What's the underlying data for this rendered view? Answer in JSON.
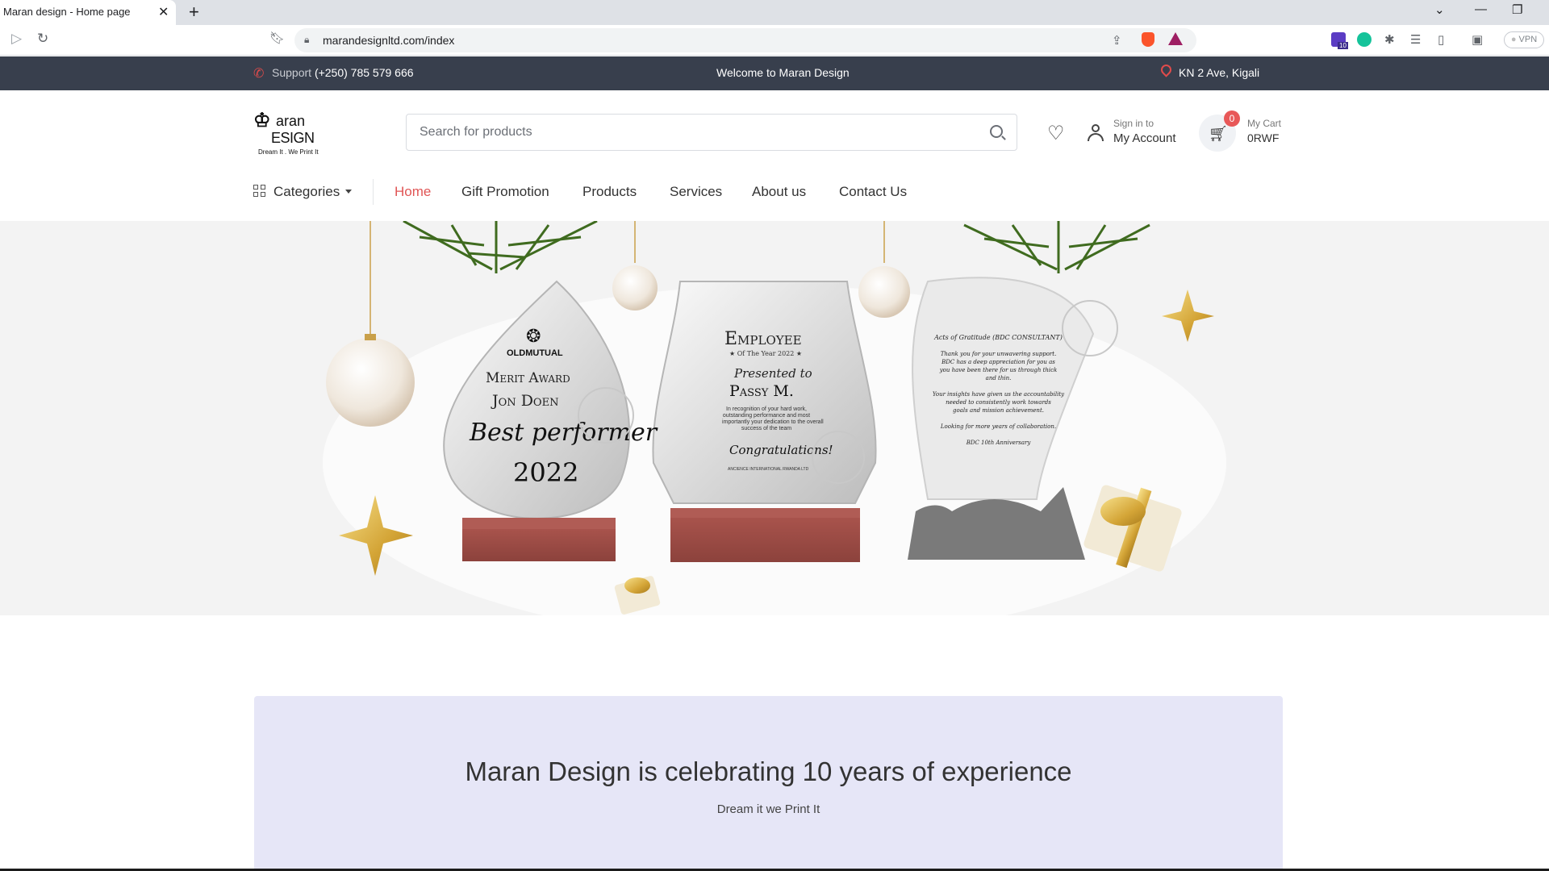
{
  "browser": {
    "tab_title": "Maran design - Home page",
    "url": "marandesignltd.com/index",
    "vpn_label": "VPN",
    "ext_badge": "10"
  },
  "topbar": {
    "support_label": "Support",
    "support_phone": "(+250) 785 579 666",
    "welcome": "Welcome to Maran Design",
    "location": "KN 2 Ave, Kigali"
  },
  "logo": {
    "line1": "aran",
    "line2": "ESIGN",
    "tagline": "Dream It . We Print It"
  },
  "search": {
    "placeholder": "Search for products"
  },
  "account": {
    "small": "Sign in to",
    "label": "My Account"
  },
  "cart": {
    "badge": "0",
    "small": "My Cart",
    "amount": "0RWF"
  },
  "nav": {
    "categories": "Categories",
    "links": [
      "Home",
      "Gift Promotion",
      "Products",
      "Services",
      "About us",
      "Contact Us"
    ],
    "active_index": 0
  },
  "hero": {
    "award1": {
      "brand": "OLDMUTUAL",
      "title": "Merit Award",
      "name": "Jon Doen",
      "script": "Best performer",
      "year": "2022"
    },
    "award2": {
      "title": "Employee",
      "subtitle": "★ Of The Year 2022 ★",
      "presented": "Presented to",
      "name": "Passy M.",
      "body1": "In recognition of your hard work,",
      "body2": "outstanding performance and most",
      "body3": "importantly your dedication to the overall",
      "body4": "success of the team",
      "script": "Congratulations!",
      "footer": "ANCIENCE INTERNATIONAL RWANDA LTD"
    },
    "award3": {
      "title": "Acts of Gratitude (BDC CONSULTANT)",
      "p1a": "Thank you for your unwavering support.",
      "p1b": "BDC has a deep appreciation for you as",
      "p1c": "you have been there for us through thick",
      "p1d": "and thin.",
      "p2a": "Your insights have given us the accountability",
      "p2b": "needed to consistently work towards",
      "p2c": "goals and mission achievement.",
      "p3": "Looking for more years of collaboration.",
      "p4": "BDC 10th Anniversary"
    }
  },
  "celebrate": {
    "title": "Maran Design is celebrating 10 years of experience",
    "subtitle": "Dream it we Print It"
  },
  "colors": {
    "topbar_bg": "#383f4d",
    "accent_red": "#e05555",
    "celebrate_bg": "#e6e6f7",
    "trophy_base": "#9d4b45"
  }
}
